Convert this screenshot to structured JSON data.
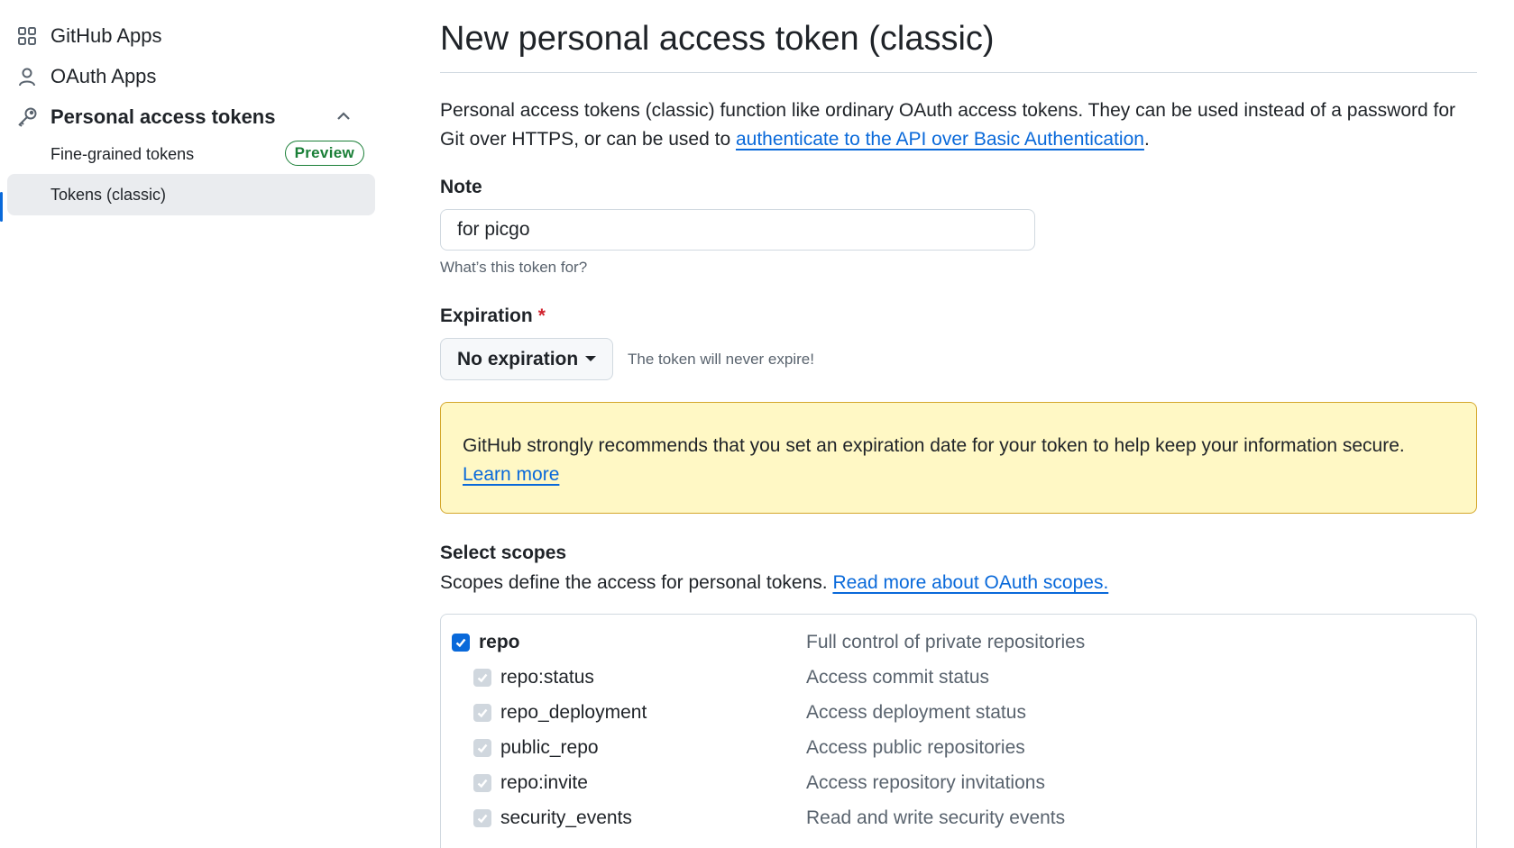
{
  "sidebar": {
    "github_apps": "GitHub Apps",
    "oauth_apps": "OAuth Apps",
    "personal_access_tokens": "Personal access tokens",
    "fine_grained": "Fine-grained tokens",
    "preview_badge": "Preview",
    "tokens_classic": "Tokens (classic)"
  },
  "main": {
    "title": "New personal access token (classic)",
    "intro_text": "Personal access tokens (classic) function like ordinary OAuth access tokens. They can be used instead of a password for Git over HTTPS, or can be used to ",
    "intro_link": "authenticate to the API over Basic Authentication",
    "intro_end": ".",
    "note_label": "Note",
    "note_value": "for picgo",
    "note_help": "What’s this token for?",
    "expiration_label": "Expiration",
    "required_mark": "*",
    "expiration_value": "No expiration",
    "expiration_note": "The token will never expire!",
    "warning_text": "GitHub strongly recommends that you set an expiration date for your token to help keep your information secure.",
    "warning_link": "Learn more",
    "scopes_title": "Select scopes",
    "scopes_desc": "Scopes define the access for personal tokens.",
    "scopes_link": "Read more about OAuth scopes."
  },
  "scopes": [
    {
      "name": "repo",
      "desc": "Full control of private repositories",
      "checked": true,
      "parent": true
    },
    {
      "name": "repo:status",
      "desc": "Access commit status",
      "checked": true,
      "parent": false
    },
    {
      "name": "repo_deployment",
      "desc": "Access deployment status",
      "checked": true,
      "parent": false
    },
    {
      "name": "public_repo",
      "desc": "Access public repositories",
      "checked": true,
      "parent": false
    },
    {
      "name": "repo:invite",
      "desc": "Access repository invitations",
      "checked": true,
      "parent": false
    },
    {
      "name": "security_events",
      "desc": "Read and write security events",
      "checked": true,
      "parent": false
    }
  ],
  "colors": {
    "accent": "#0969da",
    "success": "#1a7f37",
    "warning_bg": "#fff8c5",
    "warning_border": "#d4a72c",
    "danger": "#d1242f"
  }
}
